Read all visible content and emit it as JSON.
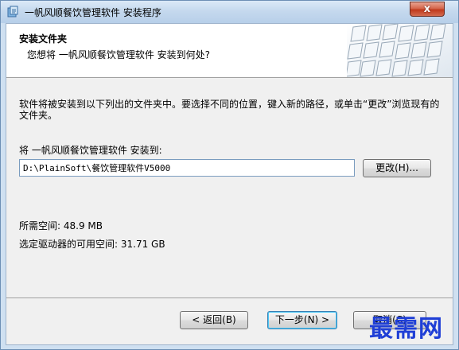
{
  "window": {
    "title": "一帆风顺餐饮管理软件 安装程序",
    "close_glyph": "x"
  },
  "header": {
    "title": "安装文件夹",
    "subtitle": "您想将 一帆风顺餐饮管理软件 安装到何处?"
  },
  "body": {
    "intro": "软件将被安装到以下列出的文件夹中。要选择不同的位置，键入新的路径，或单击“更改”浏览现有的文件夹。",
    "install_label": "将 一帆风顺餐饮管理软件 安装到:",
    "install_path": "D:\\PlainSoft\\餐饮管理软件V5000",
    "change_button": "更改(H)...",
    "space_required": "所需空间: 48.9 MB",
    "space_available": "选定驱动器的可用空间: 31.71 GB"
  },
  "buttons": {
    "back": "< 返回(B)",
    "next": "下一步(N) >",
    "cancel": "取消(C)"
  },
  "watermark": "最需网",
  "colors": {
    "title_gradient_top": "#dbe9f7",
    "close_red": "#c0391c",
    "client_bg": "#f0f0f0",
    "watermark_blue": "#1f3fd6"
  }
}
